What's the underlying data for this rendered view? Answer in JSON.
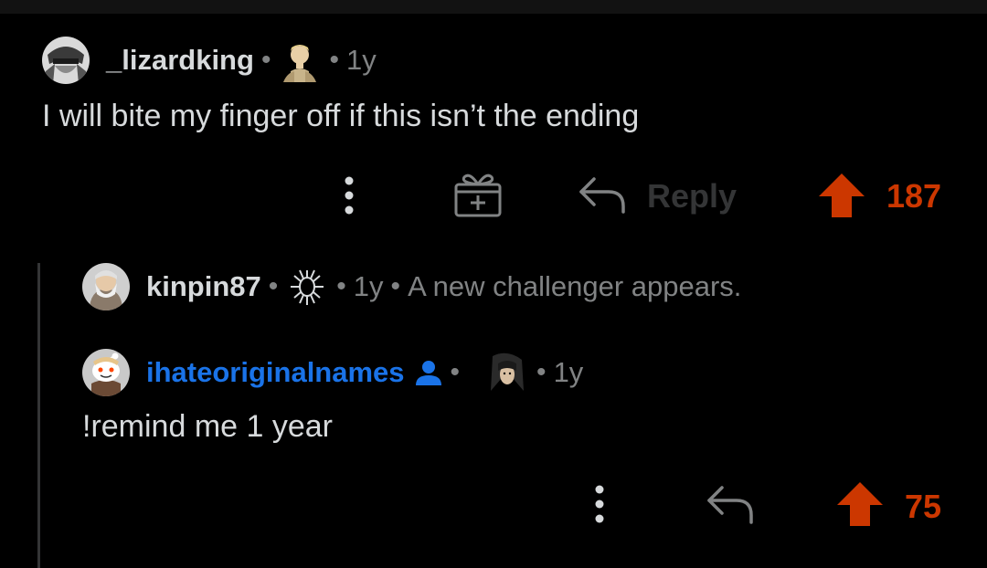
{
  "comments": [
    {
      "username": "_lizardking",
      "age": "1y",
      "text": "I will bite my finger off if this isn’t the ending",
      "reply_label": "Reply",
      "score": "187"
    },
    {
      "username": "kinpin87",
      "age": "1y",
      "flair_text": "A new challenger appears."
    },
    {
      "username": "ihateoriginalnames",
      "age": "1y",
      "text": "!remind me 1 year",
      "score": "75"
    }
  ],
  "colors": {
    "background": "#000000",
    "text": "#d7dadc",
    "muted": "#818384",
    "upvote": "#cc3700",
    "op_username": "#1a73e8",
    "disabled": "#343536"
  },
  "separator": "•",
  "icons": [
    "avatar",
    "user-flair",
    "more-options-icon",
    "award-icon",
    "reply-icon",
    "upvote-icon",
    "op-user-icon"
  ]
}
